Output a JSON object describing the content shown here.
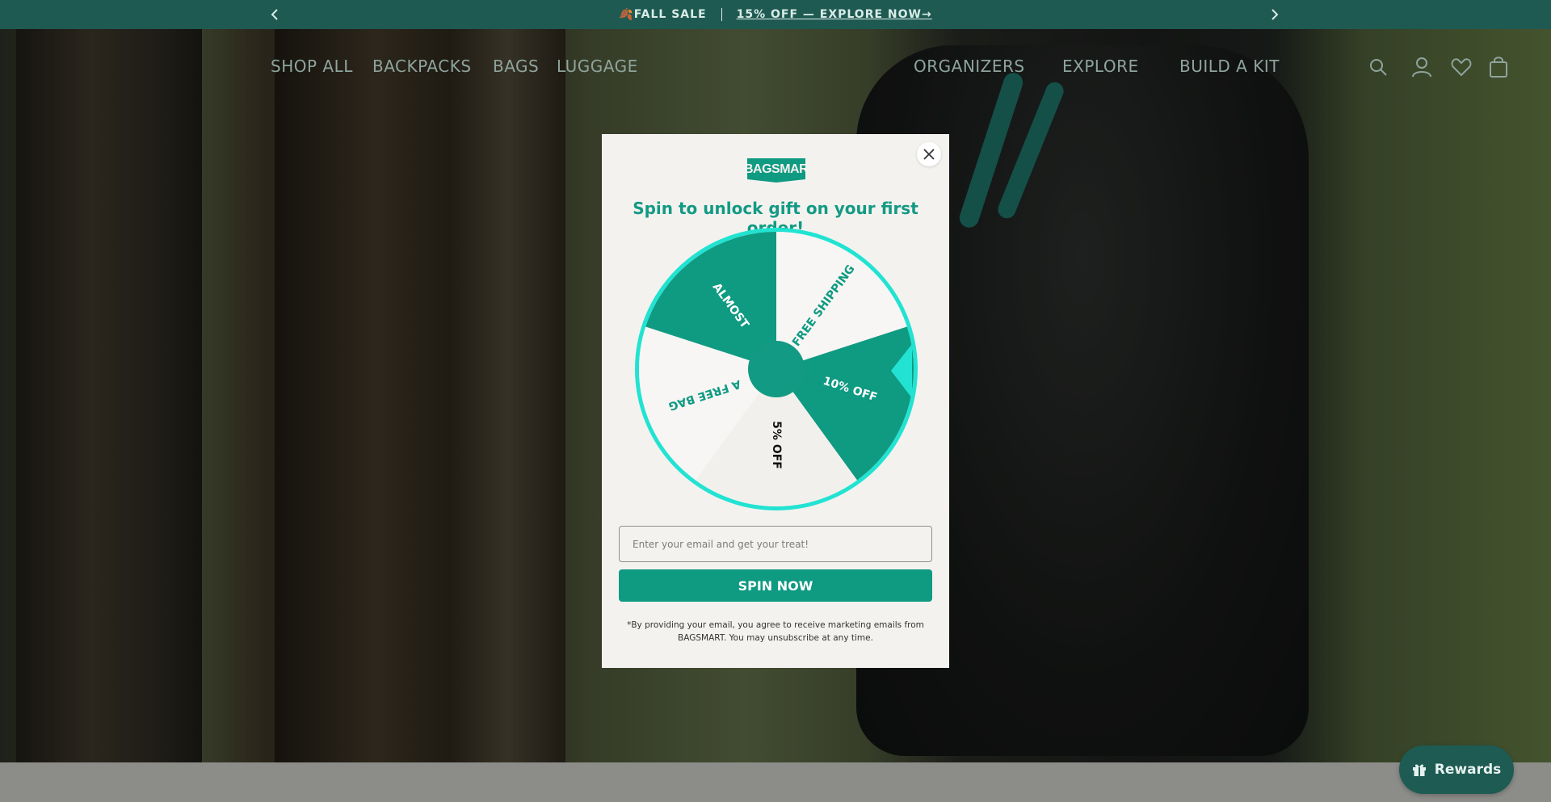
{
  "announcement": {
    "sale_label": "🍂FALL SALE",
    "offer_link": "15% OFF — EXPLORE NOW→"
  },
  "nav": {
    "left_items": [
      "SHOP ALL",
      "BACKPACKS",
      "BAGS",
      "LUGGAGE"
    ],
    "right_items": [
      "ORGANIZERS",
      "EXPLORE",
      "BUILD A KIT"
    ],
    "icons": [
      "search-icon",
      "account-icon",
      "wishlist-icon",
      "cart-icon"
    ]
  },
  "popup": {
    "logo_text": "BAGSMART",
    "headline": "Spin to unlock gift on your first order!",
    "wheel_segments": [
      "FREE SHIPPING",
      "10% OFF",
      "5% OFF",
      "A FREE BAG",
      "ALMOST"
    ],
    "email_placeholder": "Enter your email and get your treat!",
    "spin_button": "SPIN NOW",
    "disclaimer": "*By providing your email, you agree to receive marketing emails from BAGSMART. You may unsubscribe at any time."
  },
  "rewards": {
    "label": "Rewards"
  },
  "colors": {
    "brand_teal": "#0f9a82",
    "wheel_pointer": "#22e3d2",
    "announcement_bg": "#1f5a52"
  }
}
